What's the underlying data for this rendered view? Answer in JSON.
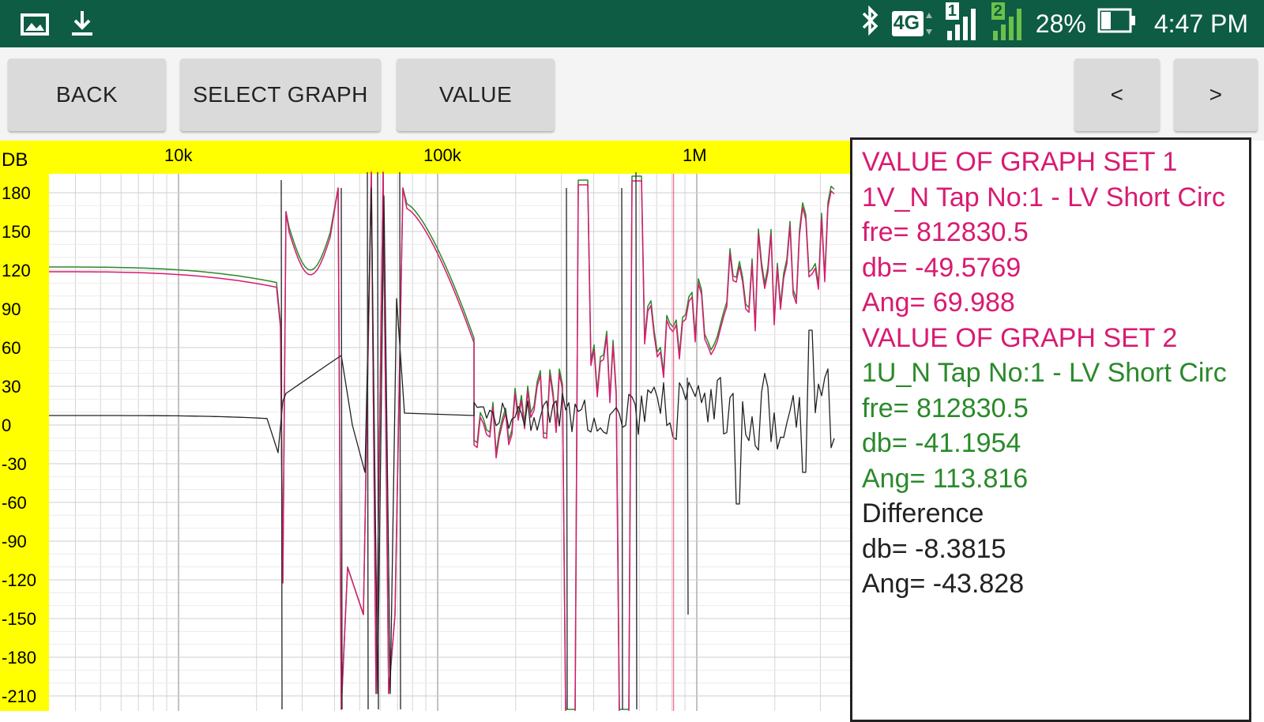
{
  "status_bar": {
    "time": "4:47 PM",
    "battery": "28%",
    "network_type": "4G",
    "sim1_label": "1",
    "sim2_label": "2",
    "icons": [
      "gallery-icon",
      "download-icon",
      "bluetooth-icon",
      "network-4g-icon",
      "sim1-signal-icon",
      "sim2-signal-icon",
      "battery-icon"
    ]
  },
  "toolbar": {
    "back_label": "BACK",
    "select_graph_label": "SELECT GRAPH",
    "value_label": "VALUE",
    "prev_label": "<",
    "next_label": ">"
  },
  "colors": {
    "status_bar": "#0d5c43",
    "axis_band": "#ffff00",
    "series_1": "#d81b72",
    "series_2": "#2a8a2a",
    "difference": "#222222"
  },
  "chart_data": {
    "type": "line",
    "ylabel": "DB",
    "x_scale": "log",
    "x_tick_labels": [
      "10k",
      "100k",
      "1M"
    ],
    "y_tick_labels": [
      "180",
      "150",
      "120",
      "90",
      "60",
      "30",
      "0",
      "-30",
      "-60",
      "-90",
      "-120",
      "-150",
      "-180",
      "-210"
    ],
    "yticks": [
      180,
      150,
      120,
      90,
      60,
      30,
      0,
      -30,
      -60,
      -90,
      -120,
      -150,
      -180,
      -210
    ],
    "grid": true,
    "cursor_frequency": 812830.5,
    "series": [
      {
        "name": "1V_N Tap No:1 - LV Short Circ"
      },
      {
        "name": "1U_N Tap No:1 - LV Short Circ"
      }
    ]
  },
  "info_panel": {
    "set1_header": "VALUE OF GRAPH SET 1",
    "set1_name": "1V_N Tap No:1 - LV Short Circ",
    "set1_fre": "fre= 812830.5",
    "set1_db": "db= -49.5769",
    "set1_ang": "Ang= 69.988",
    "set2_header": "VALUE OF GRAPH SET 2",
    "set2_name": "1U_N Tap No:1 - LV Short Circ",
    "set2_fre": "fre= 812830.5",
    "set2_db": "db= -41.1954",
    "set2_ang": "Ang= 113.816",
    "diff_header": "Difference",
    "diff_db": "db= -8.3815",
    "diff_ang": "Ang= -43.828"
  }
}
